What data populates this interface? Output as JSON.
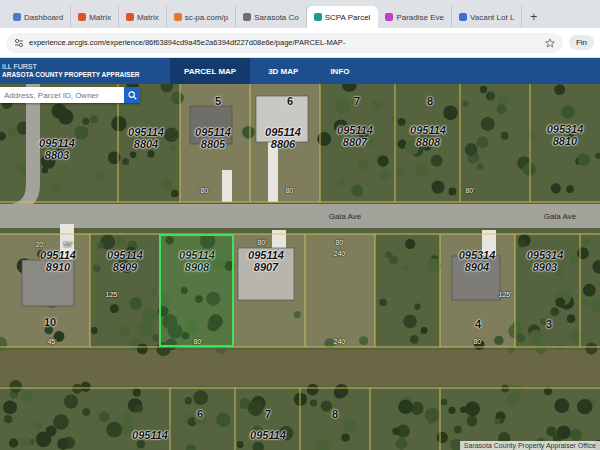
{
  "browser": {
    "tabs": [
      {
        "label": "Dashboard",
        "selected": false,
        "color": "#4a7bd0"
      },
      {
        "label": "Matrix",
        "selected": false,
        "color": "#e0502a"
      },
      {
        "label": "Matrix",
        "selected": false,
        "color": "#e0502a"
      },
      {
        "label": "sc-pa.com/p",
        "selected": false,
        "color": "#e8772e"
      },
      {
        "label": "Sarasota Co",
        "selected": false,
        "color": "#6b6f75"
      },
      {
        "label": "SCPA Parcel",
        "selected": true,
        "color": "#1a9c8c"
      },
      {
        "label": "Paradise Eve",
        "selected": false,
        "color": "#c03fc8"
      },
      {
        "label": "Vacant Lot L",
        "selected": false,
        "color": "#3b6fd1"
      }
    ],
    "new_tab": "+",
    "address": "experience.arcgis.com/experience/86f63894cd9a45e2a6394df227d08e6e/page/PARCEL-MAP-",
    "action_button": "Fin"
  },
  "app": {
    "title": [
      "ILL FURST",
      "ARASOTA COUNTY PROPERTY APPRAISER"
    ],
    "nav": [
      {
        "label": "PARCEL MAP",
        "selected": true
      },
      {
        "label": "3D MAP",
        "selected": false
      },
      {
        "label": "INFO",
        "selected": false
      }
    ],
    "search": {
      "placeholder": "Address, Parcel ID, Owner"
    }
  },
  "map": {
    "parcels": [
      {
        "prefix": "095114",
        "suffix": "8803",
        "selected": false
      },
      {
        "prefix": "095114",
        "suffix": "8804",
        "selected": false
      },
      {
        "prefix": "095114",
        "suffix": "8805",
        "selected": false
      },
      {
        "prefix": "095114",
        "suffix": "8806",
        "selected": false
      },
      {
        "prefix": "095114",
        "suffix": "8807",
        "selected": false
      },
      {
        "prefix": "095114",
        "suffix": "8808",
        "selected": false
      },
      {
        "prefix": "095314",
        "suffix": "8810",
        "selected": false
      },
      {
        "prefix": "095114",
        "suffix": "8910",
        "selected": false
      },
      {
        "prefix": "095114",
        "suffix": "8909",
        "selected": false
      },
      {
        "prefix": "095114",
        "suffix": "8908",
        "selected": true
      },
      {
        "prefix": "095114",
        "suffix": "8907",
        "selected": false
      },
      {
        "prefix": "095314",
        "suffix": "8904",
        "selected": false
      },
      {
        "prefix": "095314",
        "suffix": "8903",
        "selected": false
      },
      {
        "prefix": "095114",
        "suffix": "",
        "selected": false
      },
      {
        "prefix": "095114",
        "suffix": "",
        "selected": false
      }
    ],
    "lots": [
      "5",
      "6",
      "7",
      "8",
      "10",
      "4",
      "3",
      "6",
      "7",
      "8"
    ],
    "streets": [
      "Gala Ave",
      "Gala Ave"
    ],
    "dimensions": [
      "80'",
      "80'",
      "80'",
      "20'",
      "50'",
      "80'",
      "80'",
      "240'",
      "125'",
      "125'",
      "45'",
      "80'",
      "80'",
      "240'"
    ],
    "attribution": "Sarasota County Property Appraiser Office"
  }
}
